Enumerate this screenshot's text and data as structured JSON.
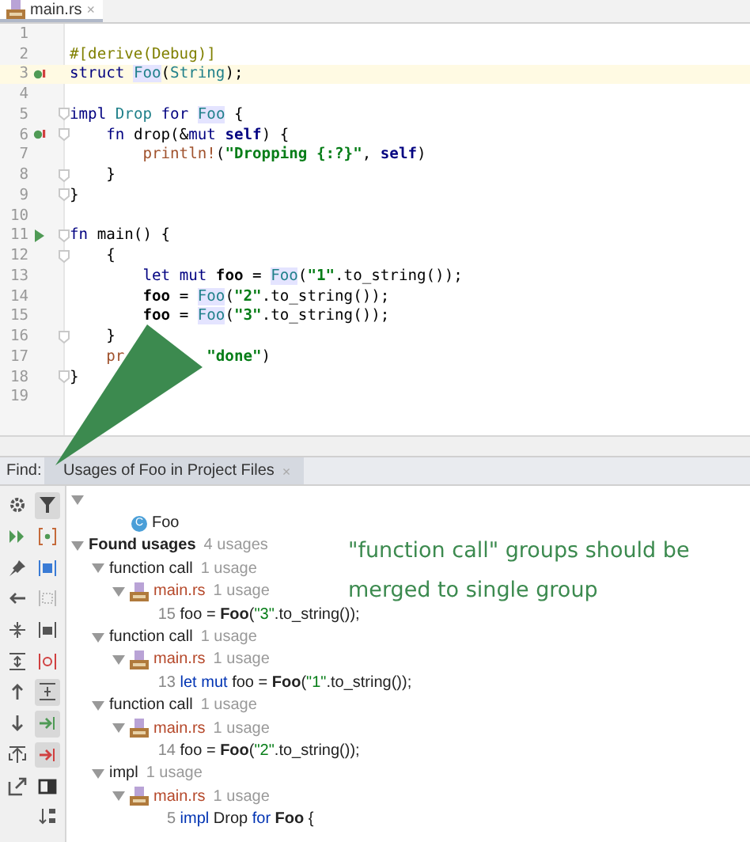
{
  "editor_tabs": [
    {
      "label": "main.rs",
      "close": "×",
      "selected": true
    }
  ],
  "code_lines": [
    {
      "number": "1",
      "current": false,
      "implemented": false,
      "runnable": false,
      "fold": false
    },
    {
      "number": "2",
      "current": false,
      "implemented": false,
      "runnable": false,
      "fold": false,
      "tokens": [
        {
          "text": "#[derive(Debug)]",
          "kind": "attr"
        }
      ]
    },
    {
      "number": "3",
      "current": true,
      "implemented": true,
      "runnable": false,
      "fold": false,
      "tokens": [
        {
          "text": "struct ",
          "kind": "kw"
        },
        {
          "text": "Foo",
          "kind": "type",
          "highlight": true
        },
        {
          "text": "(",
          "kind": "plain"
        },
        {
          "text": "String",
          "kind": "type"
        },
        {
          "text": ");",
          "kind": "plain"
        }
      ]
    },
    {
      "number": "4",
      "current": false,
      "implemented": false,
      "runnable": false,
      "fold": false
    },
    {
      "number": "5",
      "current": false,
      "implemented": false,
      "runnable": false,
      "fold": true,
      "tokens": [
        {
          "text": "impl ",
          "kind": "kw"
        },
        {
          "text": "Drop ",
          "kind": "type"
        },
        {
          "text": "for ",
          "kind": "kw"
        },
        {
          "text": "Foo",
          "kind": "type",
          "highlight": true
        },
        {
          "text": " {",
          "kind": "plain"
        }
      ]
    },
    {
      "number": "6",
      "current": false,
      "implemented": true,
      "runnable": false,
      "fold": true,
      "tokens": [
        {
          "text": "    fn ",
          "kind": "kw"
        },
        {
          "text": "drop(&",
          "kind": "plain"
        },
        {
          "text": "mut ",
          "kind": "kw"
        },
        {
          "text": "self",
          "kind": "self"
        },
        {
          "text": ") {",
          "kind": "plain"
        }
      ]
    },
    {
      "number": "7",
      "current": false,
      "implemented": false,
      "runnable": false,
      "fold": false,
      "tokens": [
        {
          "text": "        println!",
          "kind": "macro"
        },
        {
          "text": "(",
          "kind": "plain"
        },
        {
          "text": "\"Dropping {:?}\"",
          "kind": "str"
        },
        {
          "text": ", ",
          "kind": "plain"
        },
        {
          "text": "self",
          "kind": "self"
        },
        {
          "text": ")",
          "kind": "plain"
        }
      ]
    },
    {
      "number": "8",
      "current": false,
      "implemented": false,
      "runnable": false,
      "fold": true,
      "tokens": [
        {
          "text": "    }",
          "kind": "plain"
        }
      ]
    },
    {
      "number": "9",
      "current": false,
      "implemented": false,
      "runnable": false,
      "fold": true,
      "tokens": [
        {
          "text": "}",
          "kind": "plain"
        }
      ]
    },
    {
      "number": "10",
      "current": false,
      "implemented": false,
      "runnable": false,
      "fold": false
    },
    {
      "number": "11",
      "current": false,
      "implemented": false,
      "runnable": true,
      "fold": true,
      "tokens": [
        {
          "text": "fn ",
          "kind": "kw"
        },
        {
          "text": "main() {",
          "kind": "plain"
        }
      ]
    },
    {
      "number": "12",
      "current": false,
      "implemented": false,
      "runnable": false,
      "fold": true,
      "tokens": [
        {
          "text": "    {",
          "kind": "plain"
        }
      ]
    },
    {
      "number": "13",
      "current": false,
      "implemented": false,
      "runnable": false,
      "fold": false,
      "tokens": [
        {
          "text": "        let ",
          "kind": "kw"
        },
        {
          "text": "mut ",
          "kind": "kw"
        },
        {
          "text": "foo",
          "kind": "var"
        },
        {
          "text": " = ",
          "kind": "plain"
        },
        {
          "text": "Foo",
          "kind": "type",
          "highlight": true
        },
        {
          "text": "(",
          "kind": "plain"
        },
        {
          "text": "\"1\"",
          "kind": "str"
        },
        {
          "text": ".to_string());",
          "kind": "plain"
        }
      ]
    },
    {
      "number": "14",
      "current": false,
      "implemented": false,
      "runnable": false,
      "fold": false,
      "tokens": [
        {
          "text": "        foo",
          "kind": "var"
        },
        {
          "text": " = ",
          "kind": "plain"
        },
        {
          "text": "Foo",
          "kind": "type",
          "highlight": true
        },
        {
          "text": "(",
          "kind": "plain"
        },
        {
          "text": "\"2\"",
          "kind": "str"
        },
        {
          "text": ".to_string());",
          "kind": "plain"
        }
      ]
    },
    {
      "number": "15",
      "current": false,
      "implemented": false,
      "runnable": false,
      "fold": false,
      "tokens": [
        {
          "text": "        foo",
          "kind": "var"
        },
        {
          "text": " = ",
          "kind": "plain"
        },
        {
          "text": "Foo",
          "kind": "type",
          "highlight": true
        },
        {
          "text": "(",
          "kind": "plain"
        },
        {
          "text": "\"3\"",
          "kind": "str"
        },
        {
          "text": ".to_string());",
          "kind": "plain"
        }
      ]
    },
    {
      "number": "16",
      "current": false,
      "implemented": false,
      "runnable": false,
      "fold": true,
      "tokens": [
        {
          "text": "    }",
          "kind": "plain"
        }
      ]
    },
    {
      "number": "17",
      "current": false,
      "implemented": false,
      "runnable": false,
      "fold": false,
      "tokens": [
        {
          "text": "    pr",
          "kind": "macro"
        },
        {
          "text": "\"done\"",
          "kind": "str",
          "covered_before": true
        },
        {
          "text": ")",
          "kind": "plain"
        }
      ]
    },
    {
      "number": "18",
      "current": false,
      "implemented": false,
      "runnable": false,
      "fold": true,
      "tokens": [
        {
          "text": "}",
          "kind": "plain"
        }
      ]
    },
    {
      "number": "19",
      "current": false,
      "implemented": false,
      "runnable": false,
      "fold": false
    }
  ],
  "find_bar": {
    "label": "Find:",
    "tabs": [
      {
        "label": "Usages of Foo in Project Files",
        "close": "×",
        "selected": true
      }
    ]
  },
  "toolbar": {
    "left": [
      {
        "kind": "settings",
        "pressed": false
      },
      {
        "kind": "rerun",
        "pressed": false
      },
      {
        "kind": "pin",
        "pressed": false
      },
      {
        "kind": "back",
        "pressed": false
      },
      {
        "kind": "expand",
        "pressed": false
      },
      {
        "kind": "collapse",
        "pressed": false
      },
      {
        "kind": "up",
        "pressed": false
      },
      {
        "kind": "down",
        "pressed": false
      },
      {
        "kind": "export",
        "pressed": false
      },
      {
        "kind": "popout",
        "pressed": false
      }
    ],
    "right": [
      {
        "kind": "filter",
        "pressed": true
      },
      {
        "kind": "braces",
        "pressed": false
      },
      {
        "kind": "square",
        "pressed": false
      },
      {
        "kind": "grid",
        "pressed": false
      },
      {
        "kind": "modules",
        "pressed": false
      },
      {
        "kind": "method",
        "pressed": false
      },
      {
        "kind": "merge",
        "pressed": true
      },
      {
        "kind": "read",
        "pressed": true
      },
      {
        "kind": "write",
        "pressed": true
      },
      {
        "kind": "preview",
        "pressed": false
      },
      {
        "kind": "sort",
        "pressed": false
      }
    ]
  },
  "tree": [
    {
      "kind": "root",
      "expanded": true,
      "children": [
        {
          "kind": "class",
          "label": "Foo",
          "badge": "C"
        }
      ]
    },
    {
      "kind": "group",
      "label": "Found usages",
      "count": "4 usages",
      "expanded": true,
      "children": [
        {
          "kind": "category",
          "label": "function call",
          "count": "1 usage",
          "expanded": true,
          "children": [
            {
              "kind": "file",
              "label": "main.rs",
              "count": "1 usage",
              "expanded": true,
              "children": [
                {
                  "kind": "usage",
                  "tokens": [
                    {
                      "text": "15",
                      "kind": "num"
                    },
                    {
                      "text": " foo = ",
                      "kind": "plain"
                    },
                    {
                      "text": "Foo",
                      "kind": "bold"
                    },
                    {
                      "text": "(",
                      "kind": "plain"
                    },
                    {
                      "text": "\"3\"",
                      "kind": "str"
                    },
                    {
                      "text": ".to_string());",
                      "kind": "plain"
                    }
                  ]
                }
              ]
            }
          ]
        },
        {
          "kind": "category",
          "label": "function call",
          "count": "1 usage",
          "expanded": true,
          "children": [
            {
              "kind": "file",
              "label": "main.rs",
              "count": "1 usage",
              "expanded": true,
              "children": [
                {
                  "kind": "usage",
                  "tokens": [
                    {
                      "text": "13",
                      "kind": "num"
                    },
                    {
                      "text": " let mut",
                      "kind": "kw"
                    },
                    {
                      "text": " foo = ",
                      "kind": "plain"
                    },
                    {
                      "text": "Foo",
                      "kind": "bold"
                    },
                    {
                      "text": "(",
                      "kind": "plain"
                    },
                    {
                      "text": "\"1\"",
                      "kind": "str"
                    },
                    {
                      "text": ".to_string());",
                      "kind": "plain"
                    }
                  ]
                }
              ]
            }
          ]
        },
        {
          "kind": "category",
          "label": "function call",
          "count": "1 usage",
          "expanded": true,
          "children": [
            {
              "kind": "file",
              "label": "main.rs",
              "count": "1 usage",
              "expanded": true,
              "children": [
                {
                  "kind": "usage",
                  "tokens": [
                    {
                      "text": "14",
                      "kind": "num"
                    },
                    {
                      "text": " foo = ",
                      "kind": "plain"
                    },
                    {
                      "text": "Foo",
                      "kind": "bold"
                    },
                    {
                      "text": "(",
                      "kind": "plain"
                    },
                    {
                      "text": "\"2\"",
                      "kind": "str"
                    },
                    {
                      "text": ".to_string());",
                      "kind": "plain"
                    }
                  ]
                }
              ]
            }
          ]
        },
        {
          "kind": "category",
          "label": "impl",
          "count": "1 usage",
          "expanded": true,
          "children": [
            {
              "kind": "file",
              "label": "main.rs",
              "count": "1 usage",
              "expanded": true,
              "children": [
                {
                  "kind": "usage",
                  "tokens": [
                    {
                      "text": "5",
                      "kind": "num"
                    },
                    {
                      "text": " impl",
                      "kind": "kw"
                    },
                    {
                      "text": " Drop ",
                      "kind": "plain"
                    },
                    {
                      "text": "for",
                      "kind": "kw"
                    },
                    {
                      "text": " Foo",
                      "kind": "bold"
                    },
                    {
                      "text": " {",
                      "kind": "plain"
                    }
                  ]
                }
              ]
            }
          ]
        }
      ]
    }
  ],
  "annotation": {
    "text": "\"function call\" groups should be merged to single group",
    "arrow": true
  }
}
